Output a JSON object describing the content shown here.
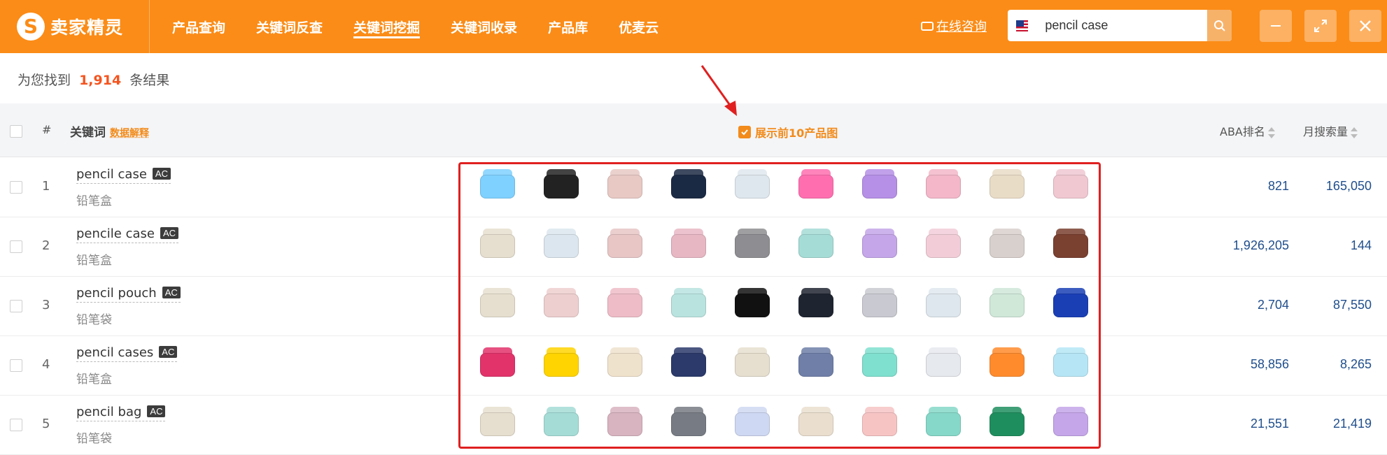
{
  "app": {
    "logo_glyph": "S",
    "brand": "卖家精灵",
    "nav": [
      "产品查询",
      "关键词反查",
      "关键词挖掘",
      "关键词收录",
      "产品库",
      "优麦云"
    ],
    "active_nav": "关键词挖掘",
    "consult": "在线咨询",
    "search_value": "pencil case",
    "accent_color": "#fb8c17"
  },
  "summary": {
    "prefix": "为您找到",
    "count": "1,914",
    "suffix": "条结果"
  },
  "table": {
    "headers": {
      "index": "#",
      "keyword": "关键词",
      "explain": "数据解释",
      "show_images": "展示前10产品图",
      "aba_rank": "ABA排名",
      "monthly_search": "月搜索量"
    },
    "rows": [
      {
        "index": "1",
        "keyword": "pencil case",
        "badge": "AC",
        "cn": "铅笔盒",
        "aba": "821",
        "volume": "165,050",
        "thumbs": [
          "#7fd1ff",
          "#222222",
          "#e8c9c4",
          "#1b2a44",
          "#dfe7ee",
          "#ff6fb0",
          "#b690e6",
          "#f3b7c9",
          "#e9dcc7",
          "#f0c8d2"
        ]
      },
      {
        "index": "2",
        "keyword": "pencile case",
        "badge": "AC",
        "cn": "铅笔盒",
        "aba": "1,926,205",
        "volume": "144",
        "thumbs": [
          "#e6dfcf",
          "#dce6ee",
          "#e8c6c6",
          "#e7b7c4",
          "#8e8e92",
          "#a5dcd6",
          "#c4a6e9",
          "#f2cdd8",
          "#d8d0cc",
          "#7a4030"
        ]
      },
      {
        "index": "3",
        "keyword": "pencil pouch",
        "badge": "AC",
        "cn": "铅笔袋",
        "aba": "2,704",
        "volume": "87,550",
        "thumbs": [
          "#e6dfcf",
          "#eecfcf",
          "#eebcc7",
          "#b9e3df",
          "#111111",
          "#1e2430",
          "#c9c9d1",
          "#dfe7ee",
          "#cfe8d8",
          "#1a3fb5"
        ]
      },
      {
        "index": "4",
        "keyword": "pencil cases",
        "badge": "AC",
        "cn": "铅笔盒",
        "aba": "58,856",
        "volume": "8,265",
        "thumbs": [
          "#e2336b",
          "#ffd400",
          "#efe2cc",
          "#2b3a6b",
          "#e6dfcf",
          "#6f7fa8",
          "#7fe0cf",
          "#e6e9ee",
          "#ff8b2d",
          "#b6e6f6"
        ]
      },
      {
        "index": "5",
        "keyword": "pencil bag",
        "badge": "AC",
        "cn": "铅笔袋",
        "aba": "21,551",
        "volume": "21,419",
        "thumbs": [
          "#e6dfcf",
          "#a5dcd6",
          "#d8b3c0",
          "#777b83",
          "#cfd8f2",
          "#eadfcf",
          "#f7c4c4",
          "#86d8c8",
          "#1f8e5e",
          "#c4a6e9"
        ]
      }
    ]
  }
}
